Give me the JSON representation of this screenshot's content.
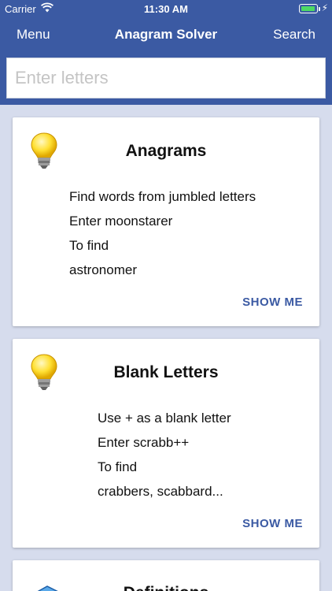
{
  "status_bar": {
    "carrier": "Carrier",
    "time": "11:30 AM",
    "wifi_icon": "wifi-icon",
    "battery_icon": "battery-icon",
    "battery_color": "#4cd964"
  },
  "nav": {
    "menu_label": "Menu",
    "title": "Anagram Solver",
    "search_label": "Search",
    "background_color": "#3b5aa3"
  },
  "search": {
    "placeholder": "Enter letters",
    "value": ""
  },
  "cards": [
    {
      "title": "Anagrams",
      "icon": "lightbulb-icon",
      "lines": [
        "Find words from jumbled letters",
        "Enter moonstarer",
        "To find",
        "astronomer"
      ],
      "action_label": "SHOW ME"
    },
    {
      "title": "Blank Letters",
      "icon": "lightbulb-icon",
      "lines": [
        "Use + as a blank letter",
        "Enter scrabb++",
        "To find",
        "crabbers, scabbard..."
      ],
      "action_label": "SHOW ME"
    },
    {
      "title": "Definitions",
      "icon": "book-icon"
    }
  ]
}
